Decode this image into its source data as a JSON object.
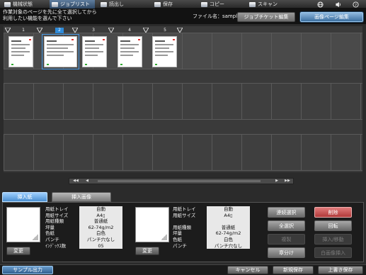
{
  "top_tabs": [
    {
      "label": "機械状態",
      "icon": "machine-status-icon"
    },
    {
      "label": "ジョブリスト",
      "icon": "job-list-icon"
    },
    {
      "label": "読出し",
      "icon": "recall-icon"
    },
    {
      "label": "保存",
      "icon": "store-icon"
    },
    {
      "label": "コピー",
      "icon": "copy-icon"
    },
    {
      "label": "スキャン",
      "icon": "scan-icon"
    }
  ],
  "header": {
    "instruction_line1": "作業対象のページを先に全て選択してから",
    "instruction_line2": "利用したい機能を選んで下さい",
    "file_label": "ファイル名：",
    "file_name": "sample02.pdf",
    "ticket_edit": "ジョブチケット編集",
    "image_edit": "画像ページ編集"
  },
  "pages": [
    {
      "num": "1",
      "selected": false
    },
    {
      "num": "2",
      "selected": true
    },
    {
      "num": "3",
      "selected": false
    },
    {
      "num": "4",
      "selected": false
    },
    {
      "num": "5",
      "selected": false
    }
  ],
  "tabs": {
    "insert_paper": "挿入紙",
    "insert_image": "挿入画像"
  },
  "left_panel": {
    "change": "変更",
    "rows": [
      {
        "k": "用紙トレイ",
        "v": "自動"
      },
      {
        "k": "用紙サイズ",
        "v": "A4▯"
      },
      {
        "k": "用紙種類",
        "v": "普通紙"
      },
      {
        "k": "坪量",
        "v": "62-74g/m2"
      },
      {
        "k": "色紙",
        "v": "白色"
      },
      {
        "k": "パンチ",
        "v": "パンチ穴なし"
      },
      {
        "k": "ｲﾝﾃﾞｯｸｽ数",
        "v": "05"
      }
    ]
  },
  "mid_panel": {
    "change": "変更",
    "rows": [
      {
        "k": "用紙トレイ",
        "v": "自動"
      },
      {
        "k": "用紙サイズ",
        "v": "A4▯"
      },
      {
        "k": "",
        "v": ""
      },
      {
        "k": "用紙種類",
        "v": "普通紙"
      },
      {
        "k": "坪量",
        "v": "62-74g/m2"
      },
      {
        "k": "色紙",
        "v": "白色"
      },
      {
        "k": "パンチ",
        "v": "パンチ穴なし"
      }
    ]
  },
  "right_buttons": {
    "continuous_select": "連続選択",
    "delete": "削除",
    "select_all": "全選択",
    "rotate": "回転",
    "duplicate": "複製",
    "insert_move": "挿入/移動",
    "chapter": "章分け",
    "image_insert": "白画像挿入"
  },
  "footer": {
    "sample_output": "サンプル出力",
    "cancel": "キャンセル",
    "new_save": "新規保存",
    "overwrite_save": "上書き保存"
  }
}
